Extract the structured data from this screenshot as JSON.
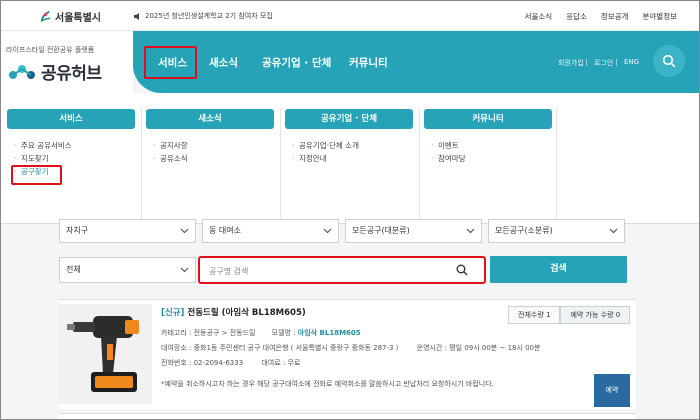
{
  "topbar": {
    "city_logo": "서울특별시",
    "notice": "2025년 청년인생설계학교 2기 참여자 모집",
    "links": [
      "서울소식",
      "응답소",
      "정보공개",
      "분야별정보"
    ]
  },
  "header": {
    "tagline": "라이프스타일 전환공유 플랫폼",
    "brand": "공유허브"
  },
  "nav": {
    "items": [
      "서비스",
      "새소식",
      "공유기업 · 단체",
      "커뮤니티"
    ],
    "right_links": [
      "회원가입",
      "로그인",
      "ENG"
    ]
  },
  "mega_menu": [
    {
      "title": "서비스",
      "items": [
        "주요 공유서비스",
        "지도찾기",
        "공구찾기"
      ]
    },
    {
      "title": "새소식",
      "items": [
        "공지사항",
        "공유소식"
      ]
    },
    {
      "title": "공유기업 · 단체",
      "items": [
        "공유기업·단체 소개",
        "지정안내"
      ]
    },
    {
      "title": "커뮤니티",
      "items": [
        "이벤트",
        "참여마당"
      ]
    }
  ],
  "filters": {
    "region": "자치구",
    "center": "동 대여소",
    "category_major": "모든공구(대분류)",
    "category_minor": "모든공구(소분류)",
    "scope": "전체",
    "search_placeholder": "공구명 검색",
    "search_button": "검색"
  },
  "result": {
    "tag": "[신규]",
    "name": "전동드릴 (아임삭 BL18M605)",
    "stock_total": "전체수량 1",
    "stock_available": "예약 가능 수량 0",
    "category_label": "카테고리 : 전동공구 > 전동드릴",
    "model_label": "모델명 : ",
    "model_value": "아임삭 BL18M605",
    "location": "대여장소 : 중화1동 주민센터 공구 대여은행 ( 서울특별시 중랑구 중화동 287-3 )",
    "hours": "운영시간 : 평일 09시 00분 ~ 18시 00분",
    "phone": "전화번호 : 02-2094-6333",
    "fee": "대여료 : 무료",
    "notice": "*예약을 취소하시고자 하는 경우 해당 공구대여소에 전화로 예약취소를 말씀하시고 반납처리 요청하시기 바랍니다.",
    "reserve_button": "예약"
  },
  "colors": {
    "accent": "#26a3b6",
    "highlight": "#e0101a",
    "reserve": "#2b6aa0"
  }
}
